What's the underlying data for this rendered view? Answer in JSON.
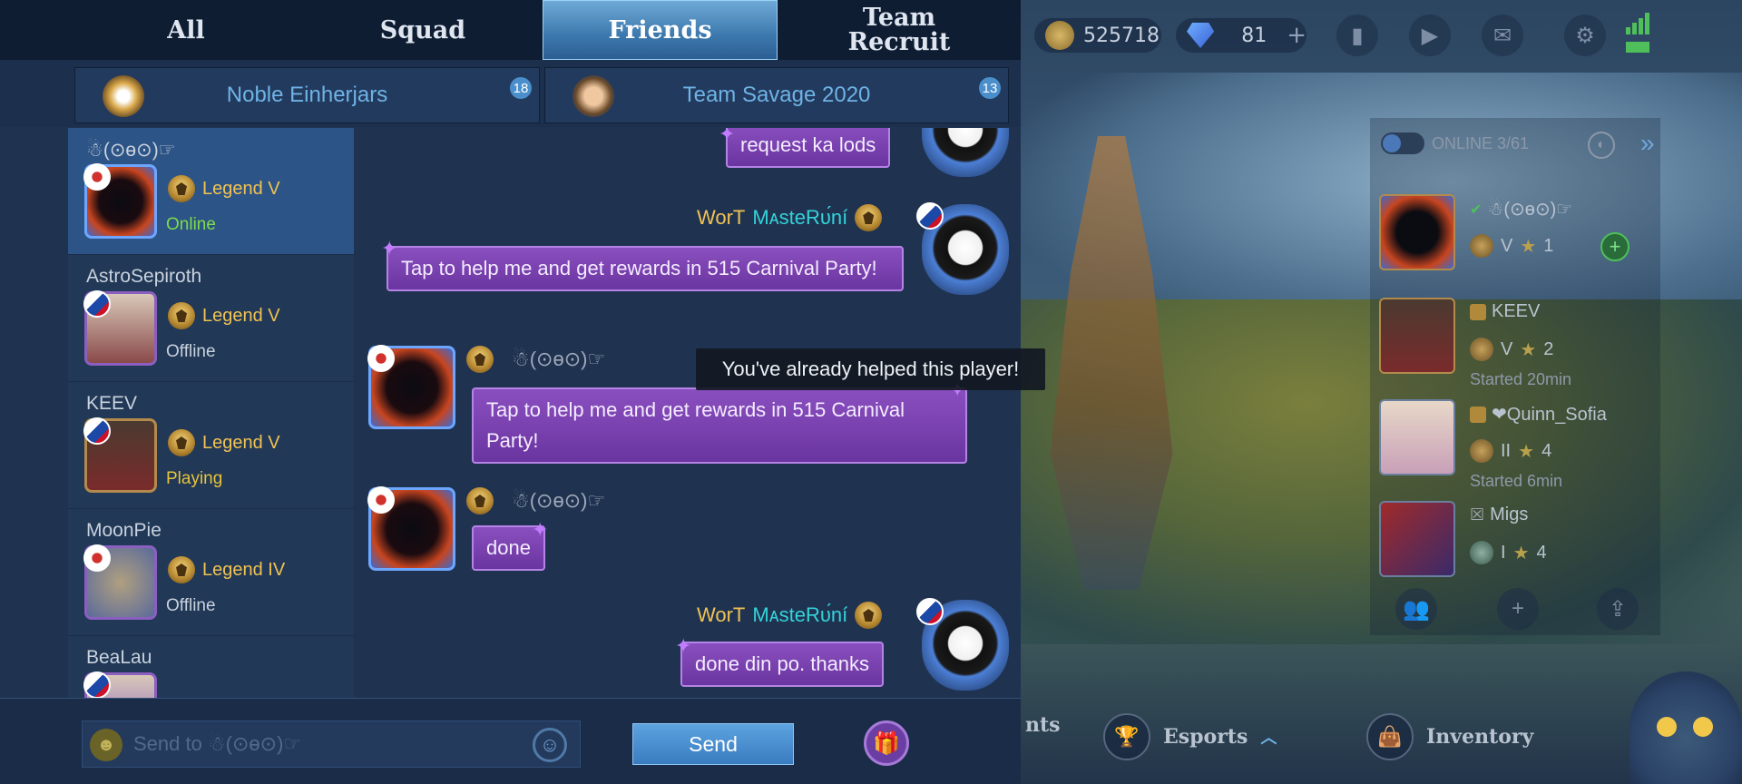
{
  "top_tabs": [
    {
      "label": "All"
    },
    {
      "label": "Squad"
    },
    {
      "label": "Friends"
    },
    {
      "label": "Team Recruit"
    }
  ],
  "active_tab": "Friends",
  "groups": [
    {
      "name": "Noble Einherjars",
      "count": "18"
    },
    {
      "name": "Team Savage 2020",
      "count": "13"
    }
  ],
  "friends": [
    {
      "name": "☃(⊙ɵ⊙)☞",
      "rank": "Legend V",
      "status": "Online"
    },
    {
      "name": "AstroSepiroth",
      "rank": "Legend V",
      "status": "Offline"
    },
    {
      "name": "KEEV",
      "rank": "Legend V",
      "status": "Playing"
    },
    {
      "name": "MoonPie",
      "rank": "Legend IV",
      "status": "Offline"
    },
    {
      "name": "BeaLau",
      "rank": "",
      "status": ""
    }
  ],
  "messages": [
    {
      "text": "request ka lods"
    },
    {
      "sender": "WorT ᴍᴀsteʀᴜ́ní",
      "text": "Tap to help me and get rewards in 515 Carnival Party!"
    },
    {
      "sender": "☃(⊙ɵ⊙)☞",
      "text": "Tap to help me and get rewards in 515 Carnival Party!"
    },
    {
      "sender": "☃(⊙ɵ⊙)☞",
      "text": "done"
    },
    {
      "sender": "WorT ᴍᴀsteʀᴜ́ní",
      "text": "done din po. thanks"
    }
  ],
  "sender_prefix": "WorT",
  "sender_suffix": "MᴀsteRᴜ́ní",
  "tooltip": "You've already helped this player!",
  "input": {
    "placeholder": "Send to ☃(⊙ɵ⊙)☞"
  },
  "send_label": "Send",
  "hud": {
    "gold": "525718",
    "diamonds": "81",
    "online_label": "ONLINE 3/61"
  },
  "right_friends": [
    {
      "name": "☃(⊙ɵ⊙)☞",
      "rank": "V",
      "stars": "1",
      "status": ""
    },
    {
      "name": "KEEV",
      "rank": "V",
      "stars": "2",
      "status": "Started 20min"
    },
    {
      "name": "❤Quinn_Sofia",
      "rank": "II",
      "stars": "4",
      "status": "Started 6min"
    },
    {
      "name": "Migs",
      "rank": "I",
      "stars": "4",
      "status": ""
    }
  ],
  "bottom_nav": [
    {
      "label": "nts"
    },
    {
      "label": "Esports"
    },
    {
      "label": "Inventory"
    }
  ],
  "colors": {
    "accent": "#3c78ad",
    "bubble": "#7a42b0",
    "rank_text": "#f0c254",
    "online": "#7ddc4a",
    "playing": "#e8c33b",
    "sender_gold": "#f0c254",
    "sender_cyan": "#35d2d8"
  }
}
